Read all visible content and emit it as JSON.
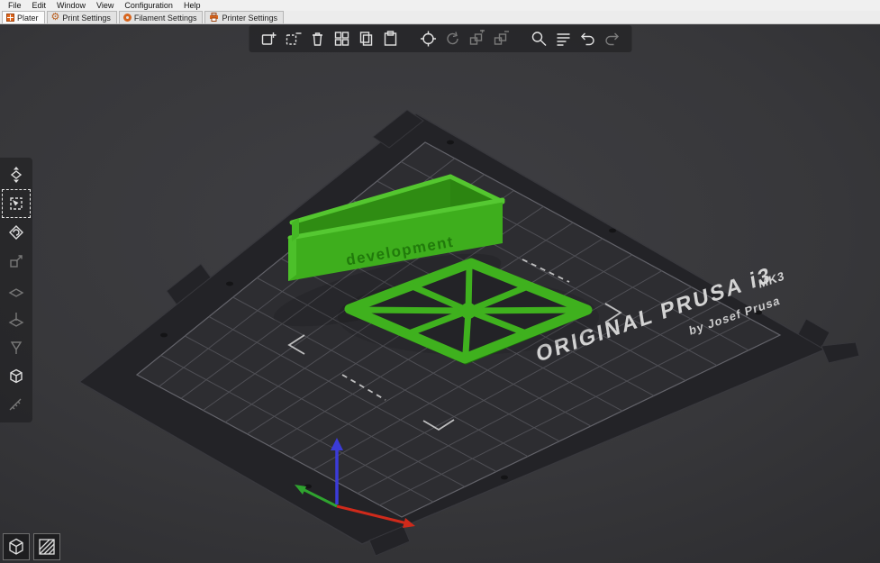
{
  "menu": {
    "items": [
      "File",
      "Edit",
      "Window",
      "View",
      "Configuration",
      "Help"
    ]
  },
  "tabs": {
    "active": "Plater",
    "items": [
      {
        "label": "Plater",
        "icon": "plater-grid-icon"
      },
      {
        "label": "Print Settings",
        "icon": "gear-icon"
      },
      {
        "label": "Filament Settings",
        "icon": "filament-spool-icon"
      },
      {
        "label": "Printer Settings",
        "icon": "printer-icon"
      }
    ]
  },
  "top_toolbar": {
    "items": [
      {
        "name": "add-object",
        "enabled": true
      },
      {
        "name": "delete-object",
        "enabled": true
      },
      {
        "name": "delete-all",
        "enabled": true
      },
      {
        "name": "arrange",
        "enabled": true
      },
      {
        "name": "copy",
        "enabled": true
      },
      {
        "name": "paste",
        "enabled": true
      },
      {
        "name": "center-instance",
        "enabled": true
      },
      {
        "name": "rotate-instance",
        "enabled": false
      },
      {
        "name": "increase-instances",
        "enabled": false
      },
      {
        "name": "decrease-instances",
        "enabled": false
      },
      {
        "name": "zoom-search",
        "enabled": true
      },
      {
        "name": "layers-list",
        "enabled": true
      },
      {
        "name": "undo",
        "enabled": true
      },
      {
        "name": "redo",
        "enabled": false
      }
    ]
  },
  "left_toolbar": {
    "active": "select",
    "items": [
      {
        "name": "move",
        "enabled": true
      },
      {
        "name": "select",
        "enabled": true
      },
      {
        "name": "rotate",
        "enabled": true
      },
      {
        "name": "scale",
        "enabled": false
      },
      {
        "name": "flatten",
        "enabled": false
      },
      {
        "name": "cut",
        "enabled": false
      },
      {
        "name": "support",
        "enabled": false
      },
      {
        "name": "camera-cube",
        "enabled": true
      },
      {
        "name": "measure",
        "enabled": false
      }
    ]
  },
  "view_buttons": {
    "items": [
      "view-3d",
      "view-layers"
    ]
  },
  "bed": {
    "brand_line1": "ORIGINAL PRUSA i3",
    "brand_mk3": "MK3",
    "brand_line2": "by Josef Prusa"
  },
  "object": {
    "label": "development"
  },
  "colors": {
    "accent_orange": "#e0661c",
    "object_green": "#3fb11e",
    "object_green_bright": "#55c832",
    "object_green_dark": "#2e8a12",
    "bed_frame": "#232327",
    "bed_sheet": "#2d2d31",
    "axis_x_red": "#cf2a1b",
    "axis_y_green": "#2fa32f",
    "axis_z_blue": "#3b3bd8"
  }
}
